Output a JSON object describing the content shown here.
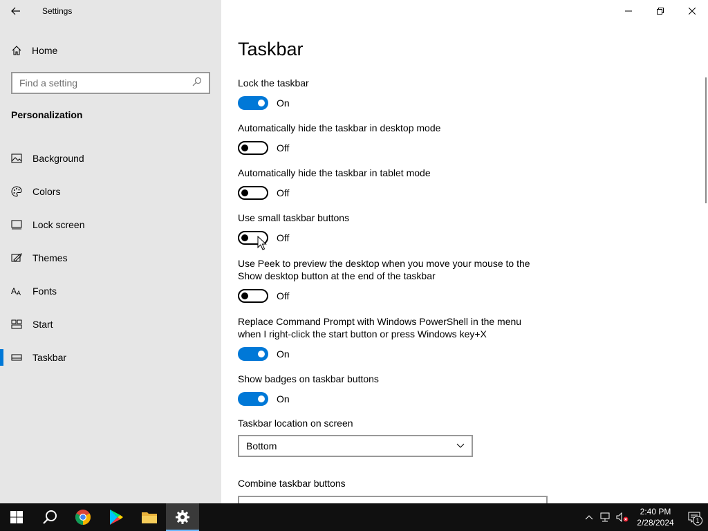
{
  "window": {
    "title": "Settings"
  },
  "sidebar": {
    "home_label": "Home",
    "search_placeholder": "Find a setting",
    "section_title": "Personalization",
    "items": [
      {
        "label": "Background",
        "icon": "picture-icon"
      },
      {
        "label": "Colors",
        "icon": "palette-icon"
      },
      {
        "label": "Lock screen",
        "icon": "lock-screen-icon"
      },
      {
        "label": "Themes",
        "icon": "themes-icon"
      },
      {
        "label": "Fonts",
        "icon": "fonts-icon"
      },
      {
        "label": "Start",
        "icon": "start-icon"
      },
      {
        "label": "Taskbar",
        "icon": "taskbar-icon",
        "active": true
      }
    ]
  },
  "main": {
    "title": "Taskbar",
    "settings": [
      {
        "desc": "Lock the taskbar",
        "state": "On"
      },
      {
        "desc": "Automatically hide the taskbar in desktop mode",
        "state": "Off"
      },
      {
        "desc": "Automatically hide the taskbar in tablet mode",
        "state": "Off"
      },
      {
        "desc": "Use small taskbar buttons",
        "state": "Off"
      },
      {
        "desc": "Use Peek to preview the desktop when you move your mouse to the Show desktop button at the end of the taskbar",
        "state": "Off"
      },
      {
        "desc": "Replace Command Prompt with Windows PowerShell in the menu when I right-click the start button or press Windows key+X",
        "state": "On"
      },
      {
        "desc": "Show badges on taskbar buttons",
        "state": "On"
      }
    ],
    "location_label": "Taskbar location on screen",
    "location_value": "Bottom",
    "combine_label": "Combine taskbar buttons"
  },
  "taskbar": {
    "time": "2:40 PM",
    "date": "2/28/2024",
    "notification_count": "1",
    "accent": "#0078d7"
  }
}
